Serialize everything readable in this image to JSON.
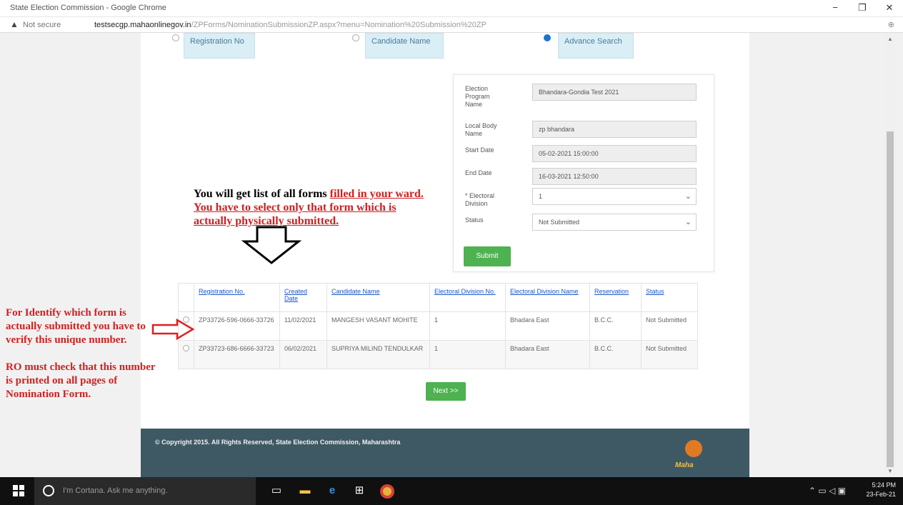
{
  "window": {
    "title": "State Election Commission - Google Chrome",
    "minimize": "−",
    "restore": "❐",
    "close": "✕"
  },
  "address_bar": {
    "security_label": "Not secure",
    "url_host": "testsecgp.mahaonlinegov.in",
    "url_path": "/ZPForms/NominationSubmissionZP.aspx?menu=Nomination%20Submission%20ZP",
    "zoom_icon": "zoom-icon"
  },
  "search_options": [
    {
      "label": "Registration No",
      "selected": false
    },
    {
      "label": "Candidate Name",
      "selected": false
    },
    {
      "label": "Advance Search",
      "selected": true
    }
  ],
  "filter_form": {
    "election_program_label": "Election Program Name",
    "election_program_value": "Bhandara-Gondia Test 2021",
    "local_body_label": "Local Body Name",
    "local_body_value": "zp bhandara",
    "start_date_label": "Start Date",
    "start_date_value": "05-02-2021 15:00:00",
    "end_date_label": "End Date",
    "end_date_value": "16-03-2021 12:50:00",
    "electoral_division_label": "* Electoral Division",
    "electoral_division_value": "1",
    "status_label": "Status",
    "status_value": "Not Submitted",
    "submit_label": "Submit"
  },
  "annotation_top": {
    "line1_black": "You will get list of all forms",
    "line1_red": "filled in your ward.",
    "line2_red": "You have to select only that form which is actually physically submitted."
  },
  "table": {
    "headers": [
      "Registration No.",
      "Created Date",
      "Candidate Name",
      "Electoral Division No.",
      "Electoral Division Name",
      "Reservation",
      "Status"
    ],
    "rows": [
      [
        "ZP33726-596-0666-33726",
        "11/02/2021",
        "MANGESH VASANT MOHITE",
        "1",
        "Bhadara East",
        "B.C.C.",
        "Not Submitted"
      ],
      [
        "ZP33723-686-6666-33723",
        "06/02/2021",
        "SUPRIYA MILIND TENDULKAR",
        "1",
        "Bhadara East",
        "B.C.C.",
        "Not Submitted"
      ]
    ]
  },
  "next_label": "Next >>",
  "annotation_left": {
    "para1": "For Identify which form is actually submitted you have to verify this unique number.",
    "para2": "RO must check that this number is printed on all pages of Nomination Form."
  },
  "footer": {
    "copyright": "© Copyright 2015. All Rights Reserved, State Election Commission, Maharashtra",
    "logo_text": "Maha"
  },
  "taskbar": {
    "cortana_placeholder": "I'm Cortana. Ask me anything.",
    "time": "5:24 PM",
    "date": "23-Feb-21"
  }
}
